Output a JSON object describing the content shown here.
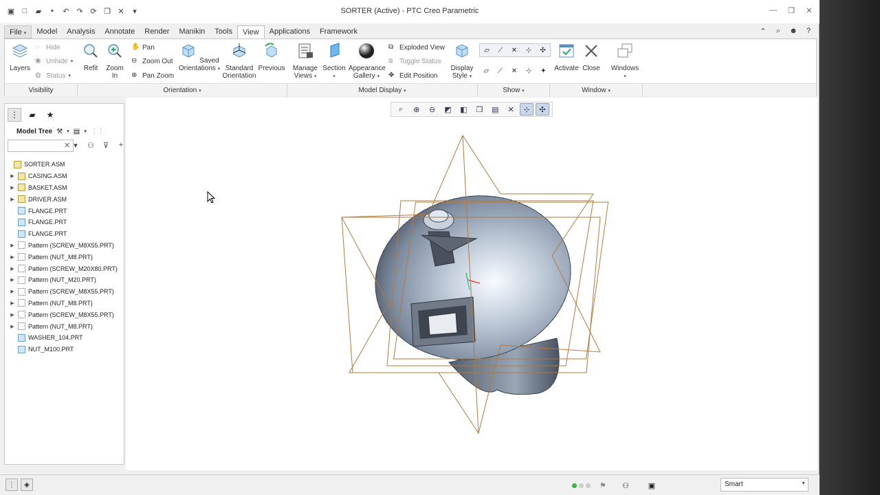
{
  "window": {
    "title": "SORTER (Active) - PTC Creo Parametric"
  },
  "quick_access": {
    "icons": [
      "app-icon",
      "new-icon",
      "open-icon",
      "save-icon",
      "undo-icon",
      "redo-icon",
      "regenerate-icon",
      "windows-icon",
      "close-window-icon",
      "customize-icon"
    ]
  },
  "tabs": [
    {
      "label": "File"
    },
    {
      "label": "Model"
    },
    {
      "label": "Analysis"
    },
    {
      "label": "Annotate"
    },
    {
      "label": "Render"
    },
    {
      "label": "Manikin"
    },
    {
      "label": "Tools"
    },
    {
      "label": "View"
    },
    {
      "label": "Applications"
    },
    {
      "label": "Framework"
    }
  ],
  "ribbon": {
    "visibility": {
      "layers": "Layers",
      "hide": "Hide",
      "unhide": "Unhide",
      "status": "Status",
      "group": "Visibility"
    },
    "orientation": {
      "refit": "Refit",
      "zoom_in": "Zoom In",
      "pan": "Pan",
      "zoom_out": "Zoom Out",
      "pan_zoom": "Pan Zoom",
      "saved_1": "Saved",
      "saved_2": "Orientations",
      "standard_1": "Standard",
      "standard_2": "Orientation",
      "previous": "Previous",
      "group": "Orientation"
    },
    "model_display": {
      "manage_1": "Manage",
      "manage_2": "Views",
      "section": "Section",
      "appearance_1": "Appearance",
      "appearance_2": "Gallery",
      "exploded": "Exploded View",
      "toggle": "Toggle Status",
      "edit_pos": "Edit Position",
      "display_1": "Display",
      "display_2": "Style",
      "group": "Model Display"
    },
    "show": {
      "group": "Show"
    },
    "window": {
      "activate": "Activate",
      "close": "Close",
      "windows": "Windows",
      "group": "Window"
    }
  },
  "model_tree": {
    "title": "Model Tree",
    "search_placeholder": "",
    "items": [
      {
        "label": "SORTER.ASM",
        "type": "asm",
        "expandable": false,
        "indent": 0
      },
      {
        "label": "CASING.ASM",
        "type": "asm",
        "expandable": true,
        "indent": 1
      },
      {
        "label": "BASKET.ASM",
        "type": "asm",
        "expandable": true,
        "indent": 1
      },
      {
        "label": "DRIVER.ASM",
        "type": "asm",
        "expandable": true,
        "indent": 1
      },
      {
        "label": "FLANGE.PRT",
        "type": "prt",
        "expandable": false,
        "indent": 1
      },
      {
        "label": "FLANGE.PRT",
        "type": "prt",
        "expandable": false,
        "indent": 1
      },
      {
        "label": "FLANGE.PRT",
        "type": "prt",
        "expandable": false,
        "indent": 1
      },
      {
        "label": "Pattern (SCREW_M8X55.PRT)",
        "type": "pat",
        "expandable": true,
        "indent": 1
      },
      {
        "label": "Pattern (NUT_M8.PRT)",
        "type": "pat",
        "expandable": true,
        "indent": 1
      },
      {
        "label": "Pattern (SCREW_M20X80.PRT)",
        "type": "pat",
        "expandable": true,
        "indent": 1
      },
      {
        "label": "Pattern (NUT_M20.PRT)",
        "type": "pat",
        "expandable": true,
        "indent": 1
      },
      {
        "label": "Pattern (SCREW_M8X55.PRT)",
        "type": "pat",
        "expandable": true,
        "indent": 1
      },
      {
        "label": "Pattern (NUT_M8.PRT)",
        "type": "pat",
        "expandable": true,
        "indent": 1
      },
      {
        "label": "Pattern (SCREW_M8X55.PRT)",
        "type": "pat",
        "expandable": true,
        "indent": 1
      },
      {
        "label": "Pattern (NUT_M8.PRT)",
        "type": "pat",
        "expandable": true,
        "indent": 1
      },
      {
        "label": "WASHER_104.PRT",
        "type": "prt",
        "expandable": false,
        "indent": 1
      },
      {
        "label": "NUT_M100.PRT",
        "type": "prt",
        "expandable": false,
        "indent": 1
      }
    ]
  },
  "status_bar": {
    "filter": "Smart"
  },
  "colors": {
    "accent": "#3b6ea5",
    "datum_plane": "#b07a3e",
    "status_green": "#3bb34a"
  }
}
